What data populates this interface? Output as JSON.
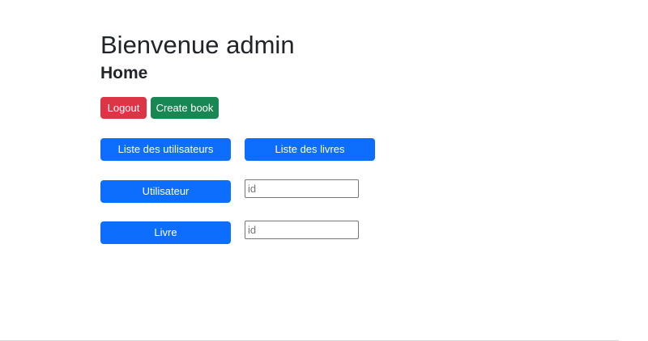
{
  "header": {
    "welcome": "Bienvenue admin",
    "page_title": "Home"
  },
  "actions": {
    "logout_label": "Logout",
    "create_book_label": "Create book"
  },
  "lists": {
    "users_label": "Liste des utilisateurs",
    "books_label": "Liste des livres"
  },
  "lookup": {
    "user_label": "Utilisateur",
    "user_placeholder": "id",
    "user_value": "",
    "book_label": "Livre",
    "book_placeholder": "id",
    "book_value": ""
  },
  "colors": {
    "danger": "#dc3545",
    "success": "#198754",
    "primary": "#0d6efd"
  }
}
